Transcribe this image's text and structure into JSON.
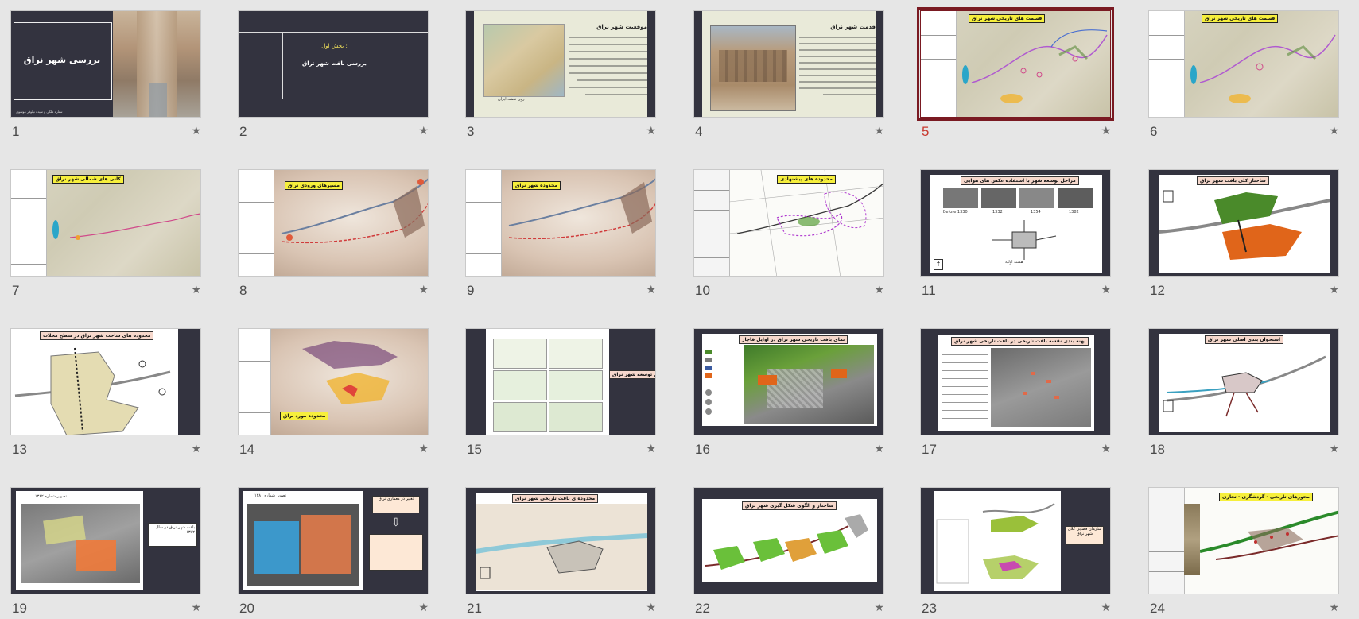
{
  "slides": [
    {
      "num": "1",
      "title": "بررسی شهر نراق",
      "subtitle": "ستاره ملکی و سیده نیلوفر موسوی"
    },
    {
      "num": "2",
      "title": "بخش اول :",
      "subtitle": "بررسی بافت شهر نراق"
    },
    {
      "num": "3",
      "title": "موقعیت شهر نراق",
      "caption": "روی نقشه ایران"
    },
    {
      "num": "4",
      "title": "قدمت شهر نراق"
    },
    {
      "num": "5",
      "title": "قسمت های تاریخی شهر نراق"
    },
    {
      "num": "6",
      "title": "قسمت های تاریخی شهر نراق"
    },
    {
      "num": "7",
      "title": "کانی های شمالی شهر نراق"
    },
    {
      "num": "8",
      "title": "مسیرهای ورودی نراق"
    },
    {
      "num": "9",
      "title": "محدوده شهر نراق"
    },
    {
      "num": "10",
      "title": "محدوده های پیشنهادی"
    },
    {
      "num": "11",
      "title": "مراحل توسعه شهر با استفاده عکس های هوایی",
      "years": [
        "Before 1330",
        "1332",
        "1354",
        "1382"
      ],
      "caption": "هسته اولیه"
    },
    {
      "num": "12",
      "title": "ساختار کلی بافت شهر نراق"
    },
    {
      "num": "13",
      "title": "محدوده های ساخت شهر نراق در سطح محلات"
    },
    {
      "num": "14",
      "title": "محدوده مورد نراق"
    },
    {
      "num": "15",
      "title": "مراحل توسعه شهر نراق"
    },
    {
      "num": "16",
      "title": "نمای بافت تاریخی شهر نراق در اوایل قاجار"
    },
    {
      "num": "17",
      "title": "پهنه بندی نقشه بافت تاریخی در بافت تاریخی شهر نراق"
    },
    {
      "num": "18",
      "title": "استخوان بندی اصلی شهر نراق"
    },
    {
      "num": "19",
      "title": "بافت شهر نراق در سال ۱۳۸۲",
      "caption": "تصویر شماره ۱۳۸۲"
    },
    {
      "num": "20",
      "title": "تغییر در معماری نراق",
      "caption": "تصویر شماره ۱۳۸۰"
    },
    {
      "num": "21",
      "title": "محدوده ی بافت تاریخی شهر نراق"
    },
    {
      "num": "22",
      "title": "ساختار و الگوی شکل گیری شهر نراق"
    },
    {
      "num": "23",
      "title": "سازمان فضایی کلان شهر نراق"
    },
    {
      "num": "24",
      "title": "محورهای تاریخی - گردشگری - تجاری"
    }
  ],
  "selected_slide": "5",
  "star_icon": "★",
  "colors": {
    "background": "#e6e6e6",
    "selection": "#7a1a22",
    "active_number": "#c8392f",
    "dark_slide": "#33333f",
    "highlight_yellow": "#f6ef3c"
  }
}
